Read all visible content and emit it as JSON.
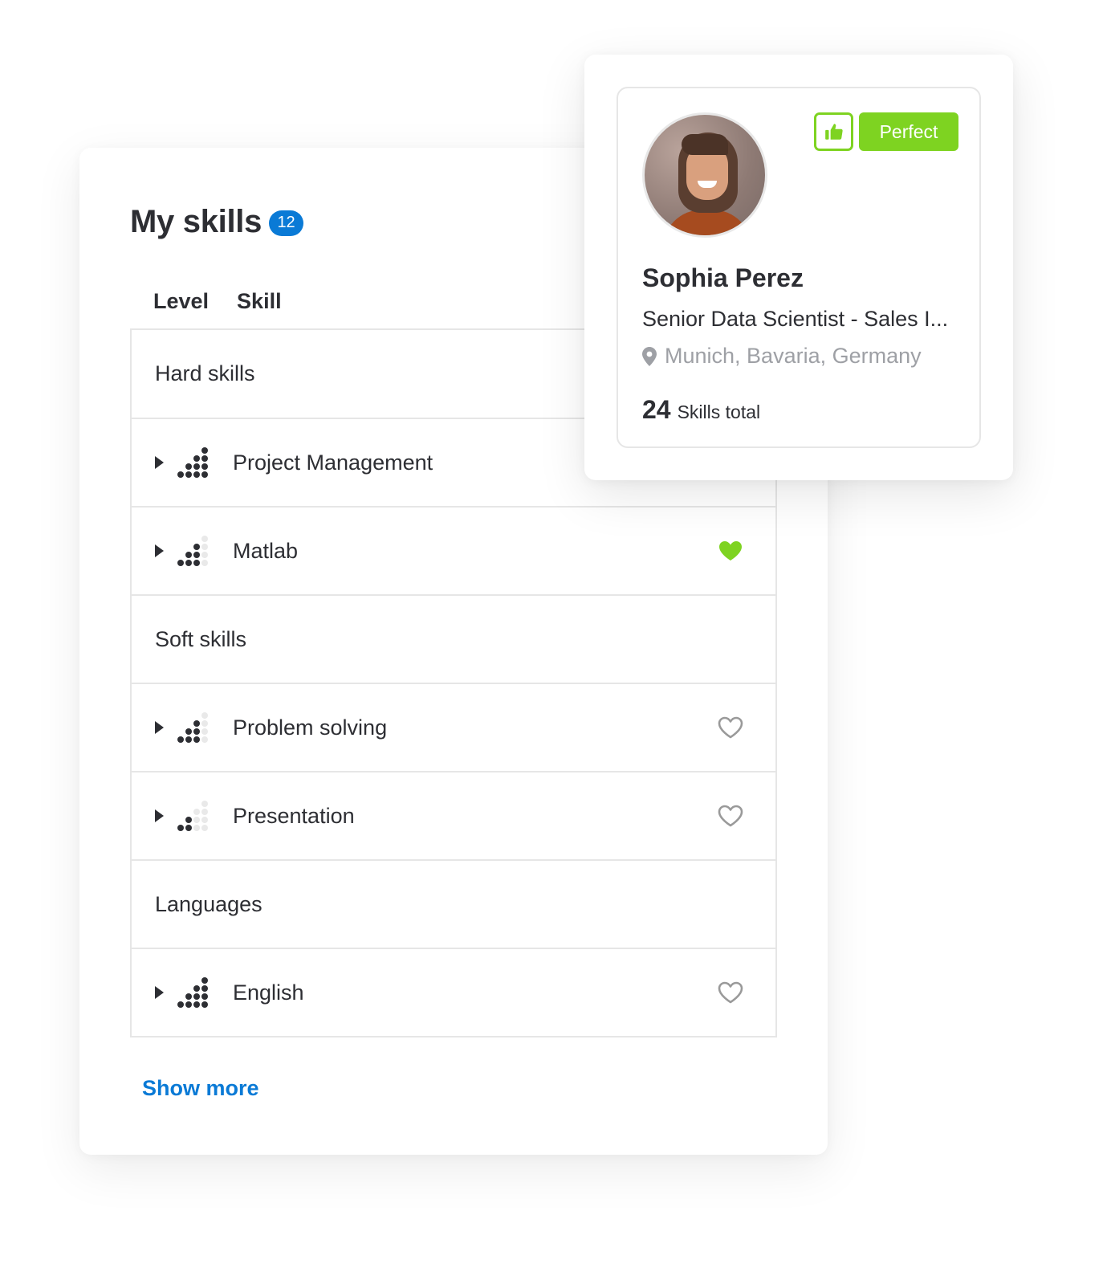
{
  "skills_card": {
    "title": "My skills",
    "count": "12",
    "columns": {
      "level": "Level",
      "skill": "Skill"
    },
    "rows": [
      {
        "type": "category",
        "label": "Hard skills"
      },
      {
        "type": "skill",
        "name": "Project Management",
        "level": 4,
        "max_level": 4,
        "favorite": null
      },
      {
        "type": "skill",
        "name": "Matlab",
        "level": 3,
        "max_level": 4,
        "favorite": true
      },
      {
        "type": "category",
        "label": "Soft skills"
      },
      {
        "type": "skill",
        "name": "Problem solving",
        "level": 3,
        "max_level": 4,
        "favorite": false
      },
      {
        "type": "skill",
        "name": "Presentation",
        "level": 2,
        "max_level": 4,
        "favorite": false
      },
      {
        "type": "category",
        "label": "Languages"
      },
      {
        "type": "skill",
        "name": "English",
        "level": 4,
        "max_level": 4,
        "favorite": false
      }
    ],
    "show_more_label": "Show more"
  },
  "profile_card": {
    "name": "Sophia Perez",
    "job_title": "Senior Data Scientist - Sales I...",
    "location": "Munich, Bavaria, Germany",
    "skills_total_count": "24",
    "skills_total_label": "Skills total",
    "match_label": "Perfect",
    "icons": {
      "thumb": "thumbs-up-icon",
      "location": "map-pin-icon"
    }
  },
  "colors": {
    "accent_blue": "#0a7ad6",
    "match_green": "#7ed321",
    "text_dark": "#2d2e33",
    "text_muted": "#9ea0a5",
    "level_off": "#e9e9e9",
    "border": "#e6e6e6"
  }
}
